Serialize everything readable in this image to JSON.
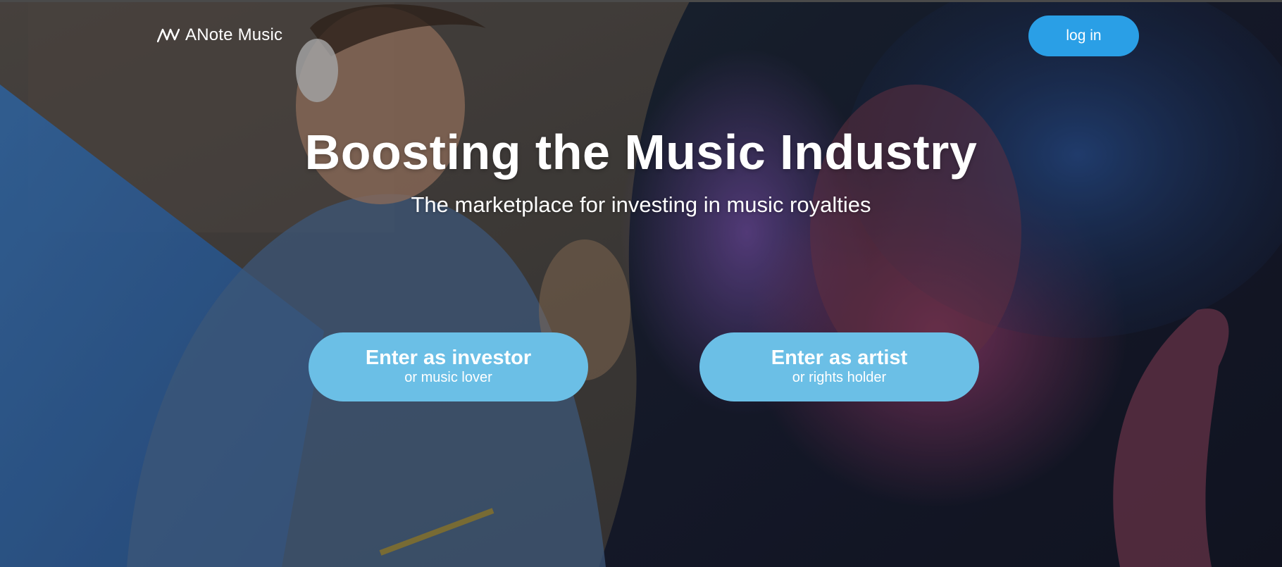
{
  "brand": {
    "name": "ANote Music"
  },
  "header": {
    "login_label": "log in"
  },
  "hero": {
    "title": "Boosting the Music Industry",
    "subtitle": "The marketplace for investing in music royalties"
  },
  "actions": {
    "investor": {
      "label": "Enter as investor",
      "sublabel": "or music lover"
    },
    "artist": {
      "label": "Enter as artist",
      "sublabel": "or rights holder"
    }
  },
  "colors": {
    "login_button": "#2a9fe6",
    "cta_button": "#6bbfe6",
    "accent_blue": "#2f6fbf",
    "text": "#ffffff"
  }
}
